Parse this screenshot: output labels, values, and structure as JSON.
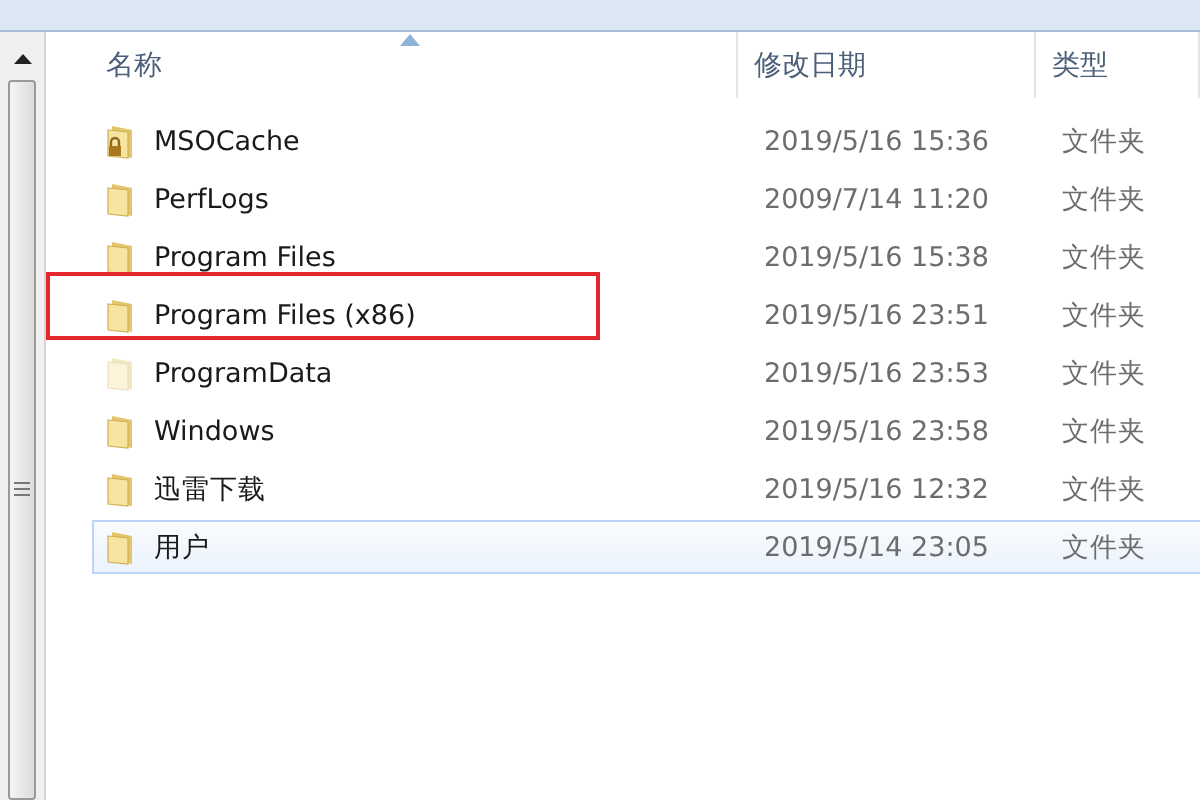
{
  "columns": [
    {
      "label": "名称",
      "sorted": true
    },
    {
      "label": "修改日期",
      "sorted": false
    },
    {
      "label": "类型",
      "sorted": false
    }
  ],
  "rows": [
    {
      "name": "MSOCache",
      "modified": "2019/5/16 15:36",
      "type": "文件夹",
      "locked": true,
      "hidden": false,
      "selected": false,
      "highlighted": false
    },
    {
      "name": "PerfLogs",
      "modified": "2009/7/14 11:20",
      "type": "文件夹",
      "locked": false,
      "hidden": false,
      "selected": false,
      "highlighted": false
    },
    {
      "name": "Program Files",
      "modified": "2019/5/16 15:38",
      "type": "文件夹",
      "locked": false,
      "hidden": false,
      "selected": false,
      "highlighted": false
    },
    {
      "name": "Program Files (x86)",
      "modified": "2019/5/16 23:51",
      "type": "文件夹",
      "locked": false,
      "hidden": false,
      "selected": false,
      "highlighted": true
    },
    {
      "name": "ProgramData",
      "modified": "2019/5/16 23:53",
      "type": "文件夹",
      "locked": false,
      "hidden": true,
      "selected": false,
      "highlighted": false
    },
    {
      "name": "Windows",
      "modified": "2019/5/16 23:58",
      "type": "文件夹",
      "locked": false,
      "hidden": false,
      "selected": false,
      "highlighted": false
    },
    {
      "name": "迅雷下载",
      "modified": "2019/5/16 12:32",
      "type": "文件夹",
      "locked": false,
      "hidden": false,
      "selected": false,
      "highlighted": false
    },
    {
      "name": "用户",
      "modified": "2019/5/14 23:05",
      "type": "文件夹",
      "locked": false,
      "hidden": false,
      "selected": true,
      "highlighted": false
    }
  ]
}
